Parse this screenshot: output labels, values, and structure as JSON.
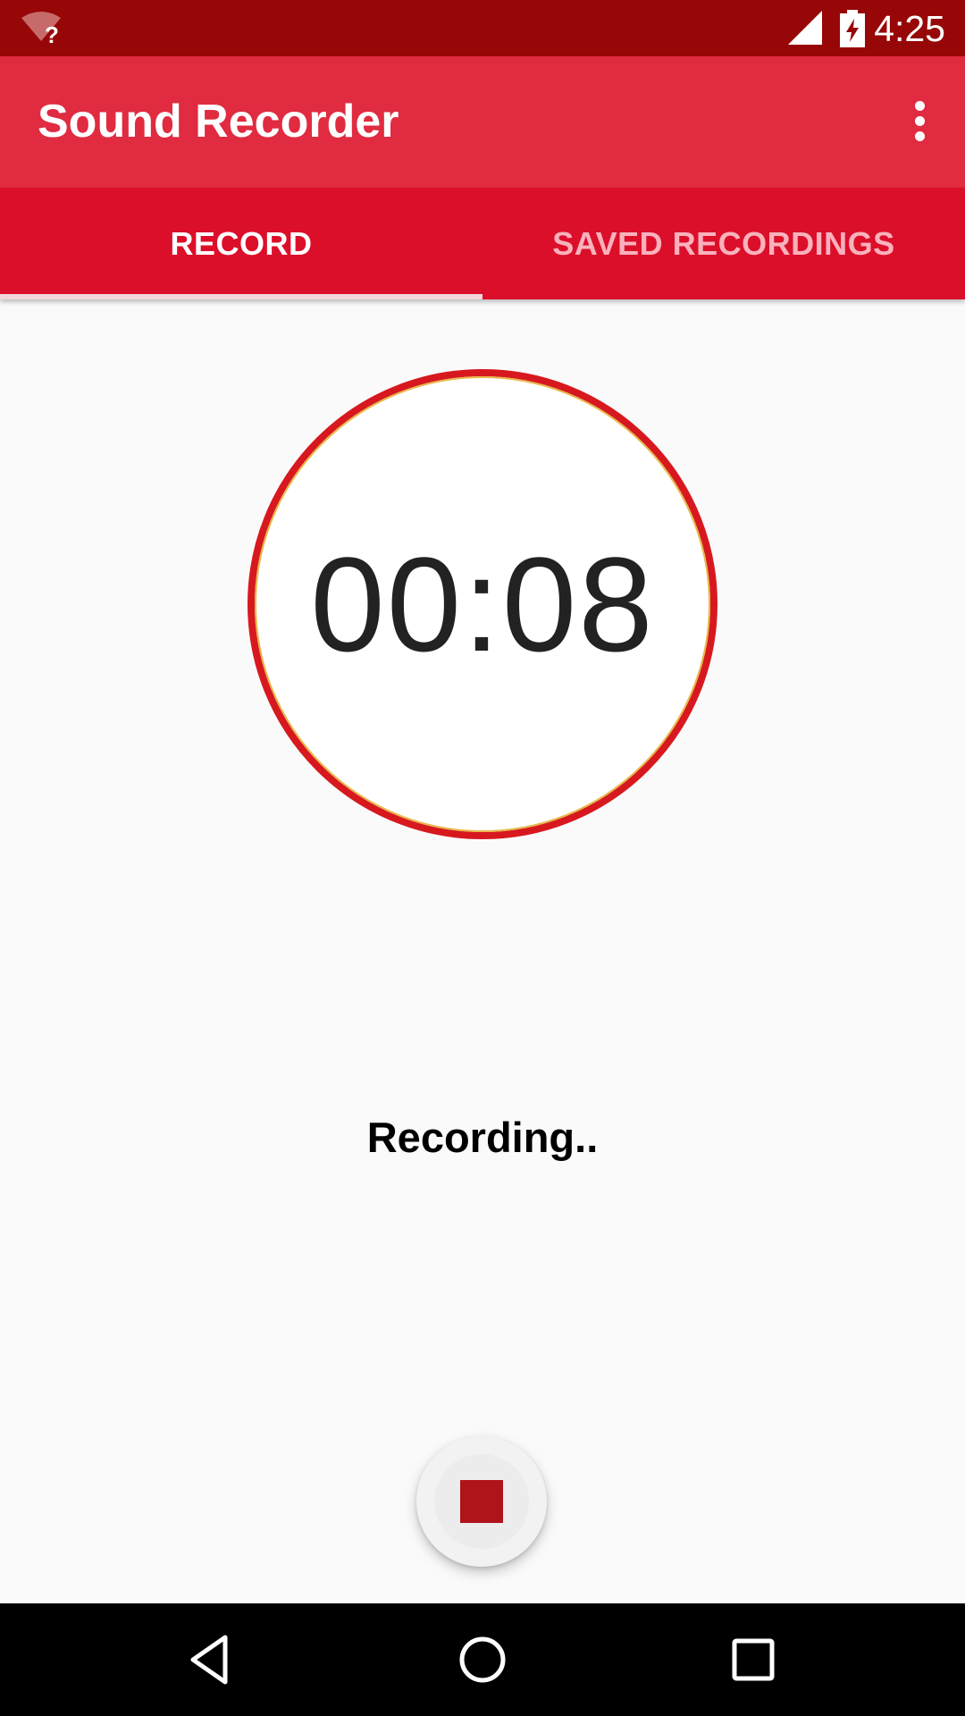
{
  "status_bar": {
    "time": "4:25",
    "icons": [
      "wifi-unknown-icon",
      "signal-icon",
      "battery-charging-icon"
    ]
  },
  "app_bar": {
    "title": "Sound Recorder",
    "menu_icon": "more-vert-icon"
  },
  "tabs": [
    {
      "label": "RECORD",
      "selected": true
    },
    {
      "label": "SAVED RECORDINGS",
      "selected": false
    }
  ],
  "recorder": {
    "elapsed": "00:08",
    "status": "Recording..",
    "stop_icon": "stop-icon"
  },
  "colors": {
    "status_bar": "#970707",
    "app_bar": "#e02b40",
    "tab_bar": "#dc0f2a",
    "ring_outer": "#d7191f",
    "ring_inner": "#e8b84a",
    "stop": "#b0141b"
  },
  "nav_bar": {
    "icons": [
      "back-icon",
      "home-icon",
      "recents-icon"
    ]
  }
}
